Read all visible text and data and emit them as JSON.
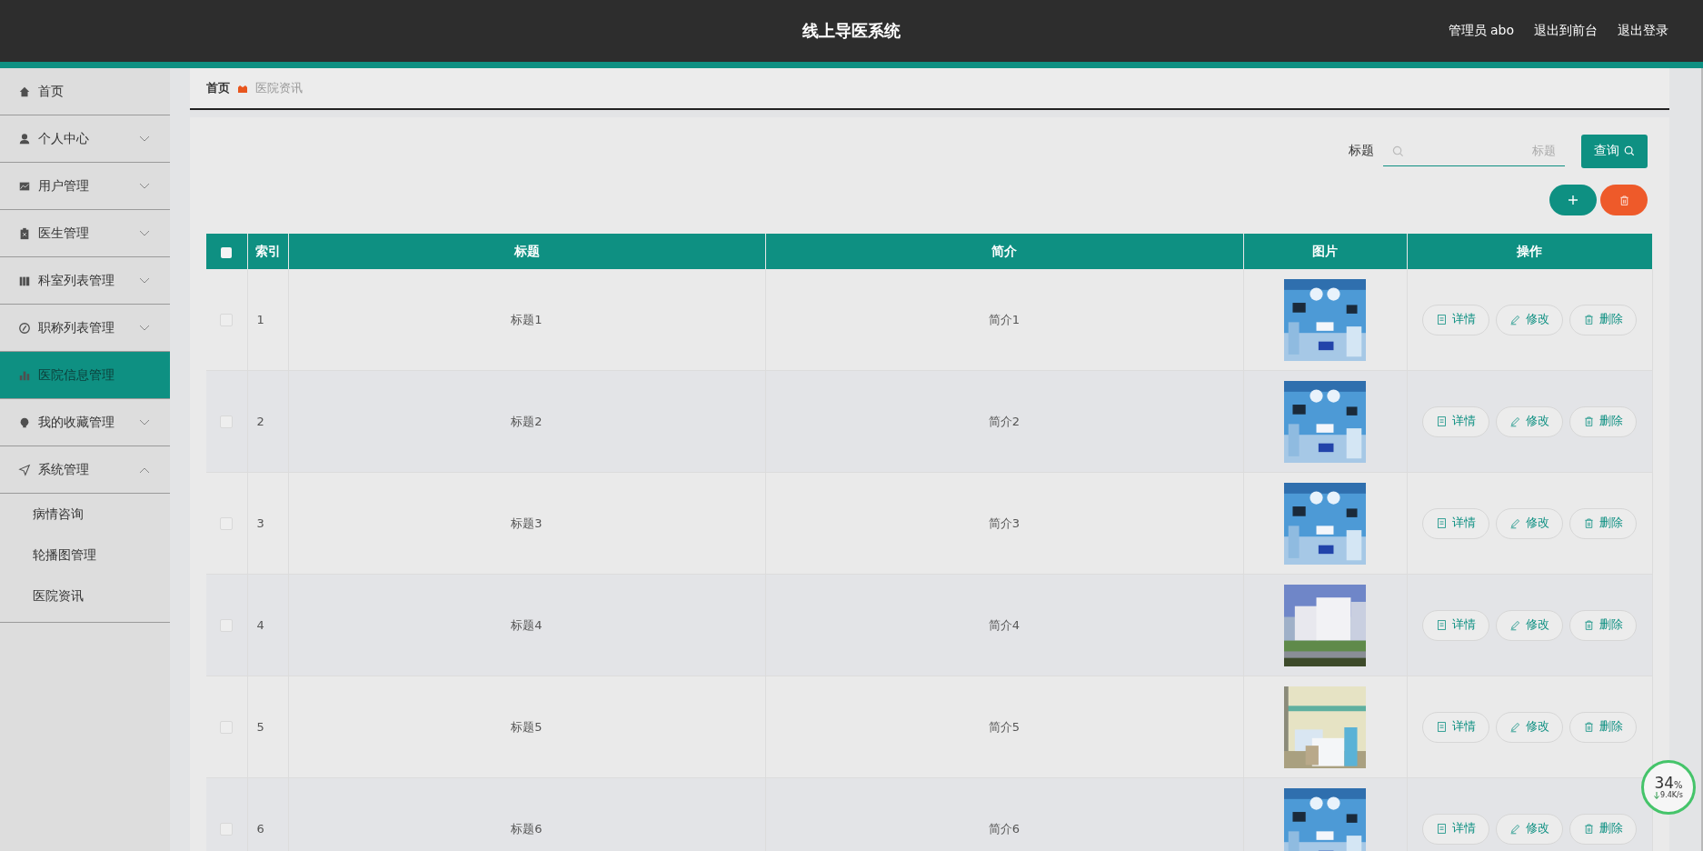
{
  "header": {
    "title": "线上导医系统",
    "links": [
      {
        "label": "管理员 abo"
      },
      {
        "label": "退出到前台"
      },
      {
        "label": "退出登录"
      }
    ]
  },
  "sidebar": {
    "items": [
      {
        "label": "首页",
        "selected": false
      },
      {
        "label": "个人中心",
        "selected": false,
        "expanded": false
      },
      {
        "label": "用户管理",
        "selected": false,
        "expanded": false
      },
      {
        "label": "医生管理",
        "selected": false,
        "expanded": false
      },
      {
        "label": "科室列表管理",
        "selected": false,
        "expanded": false
      },
      {
        "label": "职称列表管理",
        "selected": false,
        "expanded": false
      },
      {
        "label": "医院信息管理",
        "selected": true
      },
      {
        "label": "我的收藏管理",
        "selected": false,
        "expanded": false
      },
      {
        "label": "系统管理",
        "selected": false,
        "expanded": true,
        "children": [
          {
            "label": "病情咨询",
            "selected": false
          },
          {
            "label": "轮播图管理",
            "selected": false
          },
          {
            "label": "医院资讯",
            "selected": false
          }
        ]
      }
    ]
  },
  "breadcrumb": [
    {
      "label": "首页"
    },
    {
      "label": "医院资讯"
    }
  ],
  "search": {
    "label": "标题",
    "placeholder": "标题",
    "button": "查询"
  },
  "table": {
    "header_checkbox": {
      "checked": false
    },
    "columns": [
      "索引",
      "标题",
      "简介",
      "图片",
      "操作"
    ],
    "rows": [
      {
        "checked": false,
        "index": "1",
        "title": "标题1",
        "intro": "简介1",
        "kind": "picture",
        "actions": [
          "详情",
          "修改",
          "删除"
        ]
      },
      {
        "checked": false,
        "index": "2",
        "title": "标题2",
        "intro": "简介2",
        "kind": "picture",
        "actions": [
          "详情",
          "修改",
          "删除"
        ]
      },
      {
        "checked": false,
        "index": "3",
        "title": "标题3",
        "intro": "简介3",
        "kind": "picture",
        "actions": [
          "详情",
          "修改",
          "删除"
        ]
      },
      {
        "checked": false,
        "index": "4",
        "title": "标题4",
        "intro": "简介4",
        "kind": "picture",
        "actions": [
          "详情",
          "修改",
          "删除"
        ]
      },
      {
        "checked": false,
        "index": "5",
        "title": "标题5",
        "intro": "简介5",
        "kind": "picture",
        "actions": [
          "详情",
          "修改",
          "删除"
        ]
      },
      {
        "checked": false,
        "index": "6",
        "title": "标题6",
        "intro": "简介6",
        "kind": "picture",
        "actions": [
          "详情",
          "修改",
          "删除"
        ]
      }
    ]
  },
  "net_widget": {
    "percent": "34",
    "unit": "%",
    "speed": "9.4K/s"
  }
}
